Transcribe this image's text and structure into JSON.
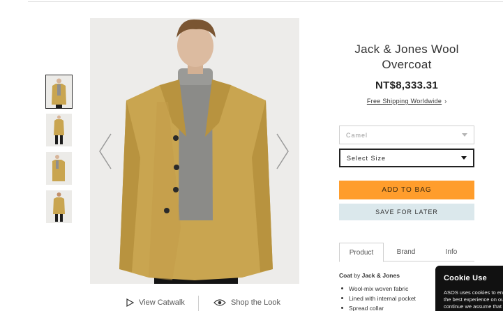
{
  "product": {
    "title": "Jack & Jones Wool Overcoat",
    "price": "NT$8,333.31",
    "shipping_link": "Free Shipping Worldwide",
    "shipping_chevron": "›"
  },
  "options": {
    "colour_value": "Camel",
    "size_placeholder": "Select Size"
  },
  "actions": {
    "add_to_bag": "ADD TO BAG",
    "save_for_later": "SAVE FOR LATER"
  },
  "media": {
    "view_catwalk": "View Catwalk",
    "shop_the_look": "Shop the Look",
    "thumbnails": [
      "front",
      "full-length",
      "side",
      "back"
    ]
  },
  "tabs": [
    "Product",
    "Brand",
    "Info"
  ],
  "details": {
    "heading_prefix": "Coat",
    "heading_by": " by ",
    "heading_brand": "Jack & Jones",
    "bullets": [
      "Wool-mix woven fabric",
      "Lined with internal pocket",
      "Spread collar"
    ]
  },
  "cookie": {
    "title": "Cookie Use",
    "line1": "ASOS uses cookies to ensure that we give you",
    "line2": "the best experience on our website. If you",
    "line3": "continue we assume that you consent"
  },
  "colors": {
    "accent": "#ff9d2c",
    "save_bg": "#dbe8ec",
    "coat": "#c9a550"
  },
  "icons": [
    "chevron-left-icon",
    "chevron-right-icon",
    "play-icon",
    "eye-icon",
    "dropdown-caret-icon"
  ]
}
